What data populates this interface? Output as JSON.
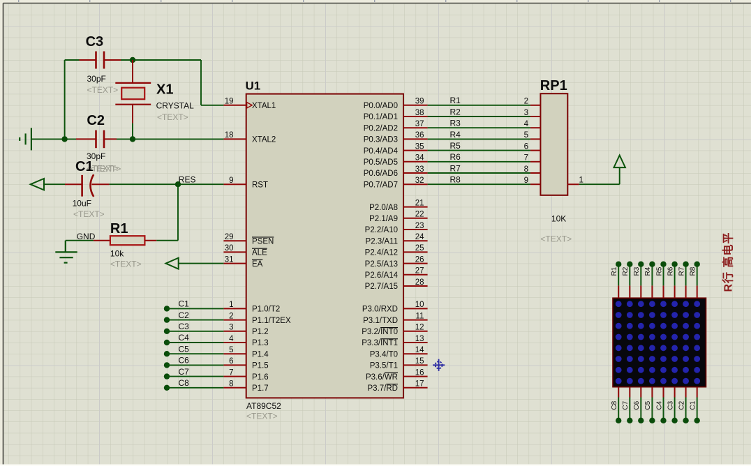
{
  "colors": {
    "background": "#dfe0d2",
    "grid_minor": "#c5c7b6",
    "grid_major": "#cbcbc9",
    "margin": "#ecebde",
    "border": "#45453f",
    "bottom_strip": "#fdfdf8",
    "wire": "#0b530b",
    "dot": "#0a4c0a",
    "lead": "#900707",
    "chip_border": "#7b0404",
    "chip_fill": "#d2d2be",
    "part_border": "#a81414",
    "part_fill": "#d6d4c0",
    "matrix_bg": "#07070c",
    "matrix_border": "#6b0000",
    "matrix_dot": "#2424ad",
    "text": "#0c0c0c",
    "gray": "#98988c",
    "annotation": "#8b1c1c",
    "origin": "#2b2ba2",
    "tick": "#9aa0ad"
  },
  "chip": {
    "ref": "U1",
    "part": "AT89C52",
    "prop": "<TEXT>",
    "left_pins": [
      {
        "num": "19",
        "name": "XTAL1"
      },
      {
        "num": "18",
        "name": "XTAL2"
      },
      {
        "num": "9",
        "name": "RST"
      },
      {
        "num": "29",
        "name": "PSEN",
        "overline": true
      },
      {
        "num": "30",
        "name": "ALE",
        "overline": true
      },
      {
        "num": "31",
        "name": "EA",
        "overline": true
      },
      {
        "num": "1",
        "name": "P1.0/T2"
      },
      {
        "num": "2",
        "name": "P1.1/T2EX"
      },
      {
        "num": "3",
        "name": "P1.2"
      },
      {
        "num": "4",
        "name": "P1.3"
      },
      {
        "num": "5",
        "name": "P1.4"
      },
      {
        "num": "6",
        "name": "P1.5"
      },
      {
        "num": "7",
        "name": "P1.6"
      },
      {
        "num": "8",
        "name": "P1.7"
      }
    ],
    "right_pins": [
      {
        "num": "39",
        "name": "P0.0/AD0"
      },
      {
        "num": "38",
        "name": "P0.1/AD1"
      },
      {
        "num": "37",
        "name": "P0.2/AD2"
      },
      {
        "num": "36",
        "name": "P0.3/AD3"
      },
      {
        "num": "35",
        "name": "P0.4/AD4"
      },
      {
        "num": "34",
        "name": "P0.5/AD5"
      },
      {
        "num": "33",
        "name": "P0.6/AD6"
      },
      {
        "num": "32",
        "name": "P0.7/AD7"
      },
      {
        "num": "21",
        "name": "P2.0/A8"
      },
      {
        "num": "22",
        "name": "P2.1/A9"
      },
      {
        "num": "23",
        "name": "P2.2/A10"
      },
      {
        "num": "24",
        "name": "P2.3/A11"
      },
      {
        "num": "25",
        "name": "P2.4/A12"
      },
      {
        "num": "26",
        "name": "P2.5/A13"
      },
      {
        "num": "27",
        "name": "P2.6/A14"
      },
      {
        "num": "28",
        "name": "P2.7/A15"
      },
      {
        "num": "10",
        "name": "P3.0/RXD"
      },
      {
        "num": "11",
        "name": "P3.1/TXD"
      },
      {
        "num": "12",
        "name": "P3.2/",
        "over": "INT0"
      },
      {
        "num": "13",
        "name": "P3.3/",
        "over": "INT1"
      },
      {
        "num": "14",
        "name": "P3.4/T0"
      },
      {
        "num": "15",
        "name": "P3.5/T1"
      },
      {
        "num": "16",
        "name": "P3.6/",
        "over": "WR"
      },
      {
        "num": "17",
        "name": "P3.7/",
        "over": "RD"
      }
    ]
  },
  "capacitors": {
    "c3": {
      "ref": "C3",
      "value": "30pF",
      "prop": "<TEXT>"
    },
    "c2": {
      "ref": "C2",
      "value": "30pF",
      "prop": "<TEXT>"
    },
    "c1": {
      "ref": "C1",
      "value": "10uF",
      "prop": "<TEXT>"
    }
  },
  "crystal": {
    "ref": "X1",
    "value": "CRYSTAL",
    "prop": "<TEXT>"
  },
  "resistor": {
    "ref": "R1",
    "value": "10k",
    "prop": "<TEXT>"
  },
  "resistor_pack": {
    "ref": "RP1",
    "value": "10K",
    "prop": "<TEXT>",
    "left_pin_numbers": [
      "2",
      "3",
      "4",
      "5",
      "6",
      "7",
      "8",
      "9"
    ],
    "right_pin_number": "1"
  },
  "net_labels": {
    "reset": "RES",
    "ground": "GND",
    "p0_nets": [
      "R1",
      "R2",
      "R3",
      "R4",
      "R5",
      "R6",
      "R7",
      "R8"
    ],
    "p1_nets": [
      "C1",
      "C2",
      "C3",
      "C4",
      "C5",
      "C6",
      "C7",
      "C8"
    ]
  },
  "led_matrix": {
    "row_labels": [
      "R1",
      "R2",
      "R3",
      "R4",
      "R5",
      "R6",
      "R7",
      "R8"
    ],
    "col_labels": [
      "C8",
      "C7",
      "C6",
      "C5",
      "C4",
      "C3",
      "C2",
      "C1"
    ]
  },
  "annotation": {
    "text": "R行 高电平"
  }
}
